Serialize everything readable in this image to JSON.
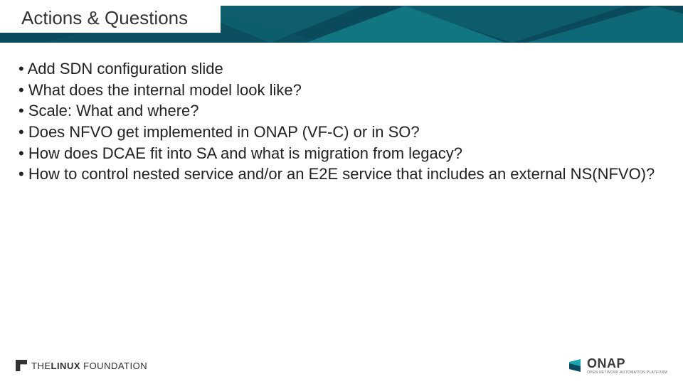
{
  "title": "Actions & Questions",
  "bullets": [
    "Add SDN configuration slide",
    "What does the internal model look like?",
    "Scale: What and where?",
    "Does NFVO get implemented in ONAP (VF-C) or in SO?",
    "How does DCAE fit into SA and what is migration from legacy?",
    "How to control nested service and/or an E2E service that includes an external NS(NFVO)?"
  ],
  "footer": {
    "linux_the": "THE",
    "linux_name": "LINUX",
    "linux_foundation": "FOUNDATION",
    "onap_name": "ONAP",
    "onap_sub": "OPEN NETWORK AUTOMATION PLATFORM"
  }
}
